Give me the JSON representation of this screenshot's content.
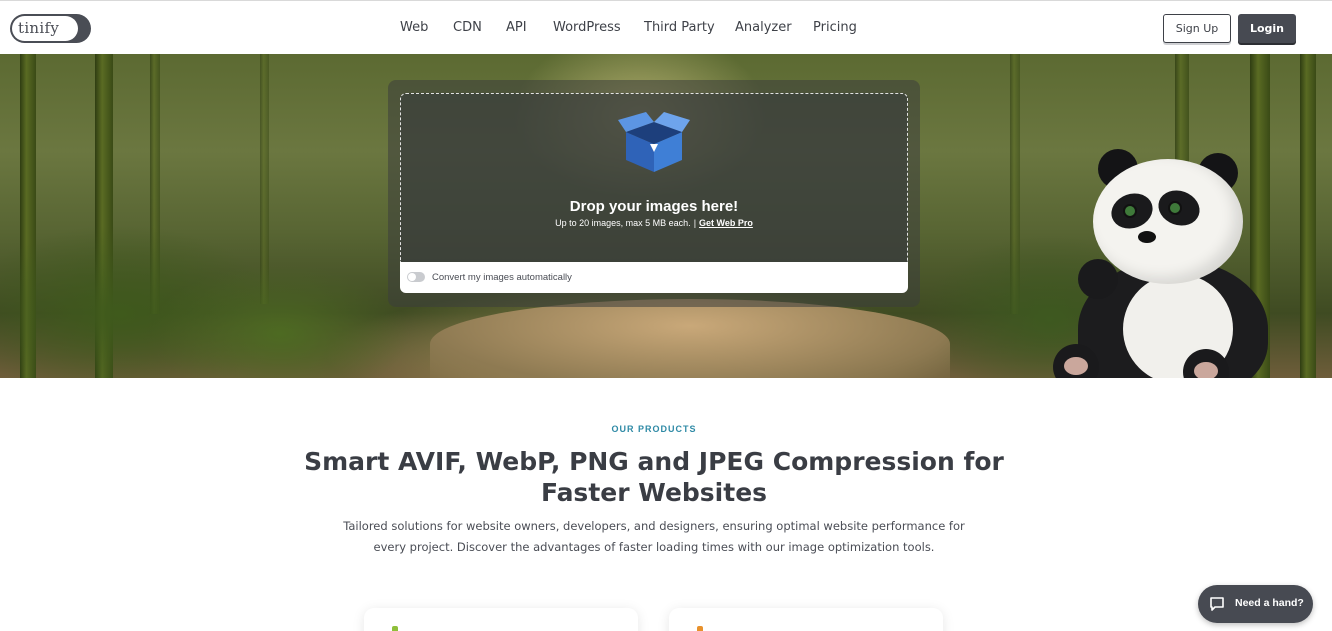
{
  "header": {
    "logo_text": "tinify",
    "nav": [
      "Web",
      "CDN",
      "API",
      "WordPress",
      "Third Party",
      "Analyzer",
      "Pricing"
    ],
    "signup_label": "Sign Up",
    "login_label": "Login"
  },
  "uploader": {
    "title": "Drop your images here!",
    "subtitle": "Up to 20 images, max 5 MB each.",
    "separator": "|",
    "link_label": "Get Web Pro",
    "toggle_label": "Convert my images automatically",
    "toggle_on": false
  },
  "products": {
    "eyebrow": "OUR PRODUCTS",
    "title": "Smart AVIF, WebP, PNG and JPEG Compression for Faster Websites",
    "description": "Tailored solutions for website owners, developers, and designers, ensuring optimal website performance for every project. Discover the advantages of faster loading times with our image optimization tools."
  },
  "help": {
    "label": "Need a hand?"
  },
  "colors": {
    "dark": "#474a52",
    "accent": "#2f8aa6",
    "card_icon_green": "#8fbf3a",
    "card_icon_orange": "#e8912c"
  }
}
